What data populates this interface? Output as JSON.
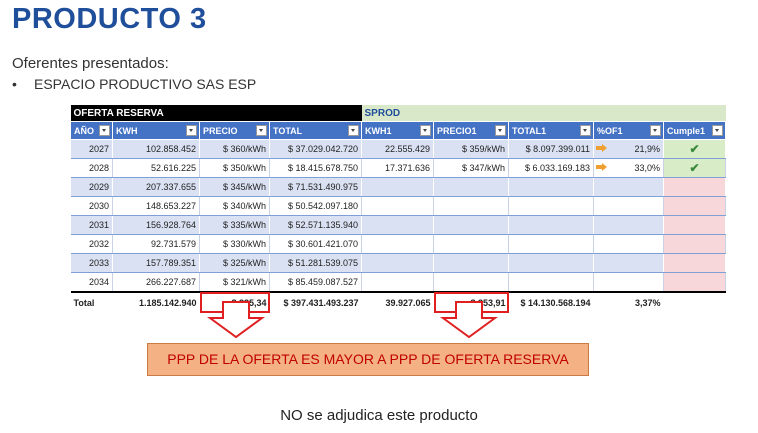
{
  "title": "PRODUCTO 3",
  "subtitle": "Oferentes presentados:",
  "bullet_marker": "•",
  "bullet": "ESPACIO PRODUCTIVO SAS ESP",
  "group_headers": {
    "left": "OFERTA RESERVA",
    "right": "SPROD"
  },
  "columns": [
    "AÑO",
    "KWH",
    "PRECIO",
    "TOTAL",
    "KWH1",
    "PRECIO1",
    "TOTAL1",
    "%OF1",
    "Cumple1"
  ],
  "rows": [
    {
      "year": "2027",
      "kwh": "102.858.452",
      "precio": "$ 360/kWh",
      "total": "$ 37.029.042.720",
      "kwh1": "22.555.429",
      "precio1": "$ 359/kWh",
      "total1": "$ 8.097.399.011",
      "of1": "21,9%",
      "cumple": "✔"
    },
    {
      "year": "2028",
      "kwh": "52.616.225",
      "precio": "$ 350/kWh",
      "total": "$ 18.415.678.750",
      "kwh1": "17.371.636",
      "precio1": "$ 347/kWh",
      "total1": "$ 6.033.169.183",
      "of1": "33,0%",
      "cumple": "✔"
    },
    {
      "year": "2029",
      "kwh": "207.337.655",
      "precio": "$ 345/kWh",
      "total": "$ 71.531.490.975",
      "kwh1": "",
      "precio1": "",
      "total1": "",
      "of1": "",
      "cumple": ""
    },
    {
      "year": "2030",
      "kwh": "148.653.227",
      "precio": "$ 340/kWh",
      "total": "$ 50.542.097.180",
      "kwh1": "",
      "precio1": "",
      "total1": "",
      "of1": "",
      "cumple": ""
    },
    {
      "year": "2031",
      "kwh": "156.928.764",
      "precio": "$ 335/kWh",
      "total": "$ 52.571.135.940",
      "kwh1": "",
      "precio1": "",
      "total1": "",
      "of1": "",
      "cumple": ""
    },
    {
      "year": "2032",
      "kwh": "92.731.579",
      "precio": "$ 330/kWh",
      "total": "$ 30.601.421.070",
      "kwh1": "",
      "precio1": "",
      "total1": "",
      "of1": "",
      "cumple": ""
    },
    {
      "year": "2033",
      "kwh": "157.789.351",
      "precio": "$ 325/kWh",
      "total": "$ 51.281.539.075",
      "kwh1": "",
      "precio1": "",
      "total1": "",
      "of1": "",
      "cumple": ""
    },
    {
      "year": "2034",
      "kwh": "266.227.687",
      "precio": "$ 321/kWh",
      "total": "$ 85.459.087.527",
      "kwh1": "",
      "precio1": "",
      "total1": "",
      "of1": "",
      "cumple": ""
    }
  ],
  "totals": {
    "label": "Total",
    "kwh": "1.185.142.940",
    "precio": "$ 335,34",
    "total": "$ 397.431.493.237",
    "kwh1": "39.927.065",
    "precio1": "$ 353,91",
    "total1": "$ 14.130.568.194",
    "of1": "3,37%"
  },
  "banner": "PPP DE LA OFERTA ES MAYOR  A PPP DE OFERTA RESERVA",
  "footer": "NO se adjudica este producto",
  "colors": {
    "title": "#1f4e9a",
    "header_blue": "#4472c4",
    "row_band": "#d9e1f2",
    "sprod_header": "#d8e8c8",
    "banner": "#f4b183",
    "banner_text": "#c00000",
    "arrow": "#e02020"
  }
}
